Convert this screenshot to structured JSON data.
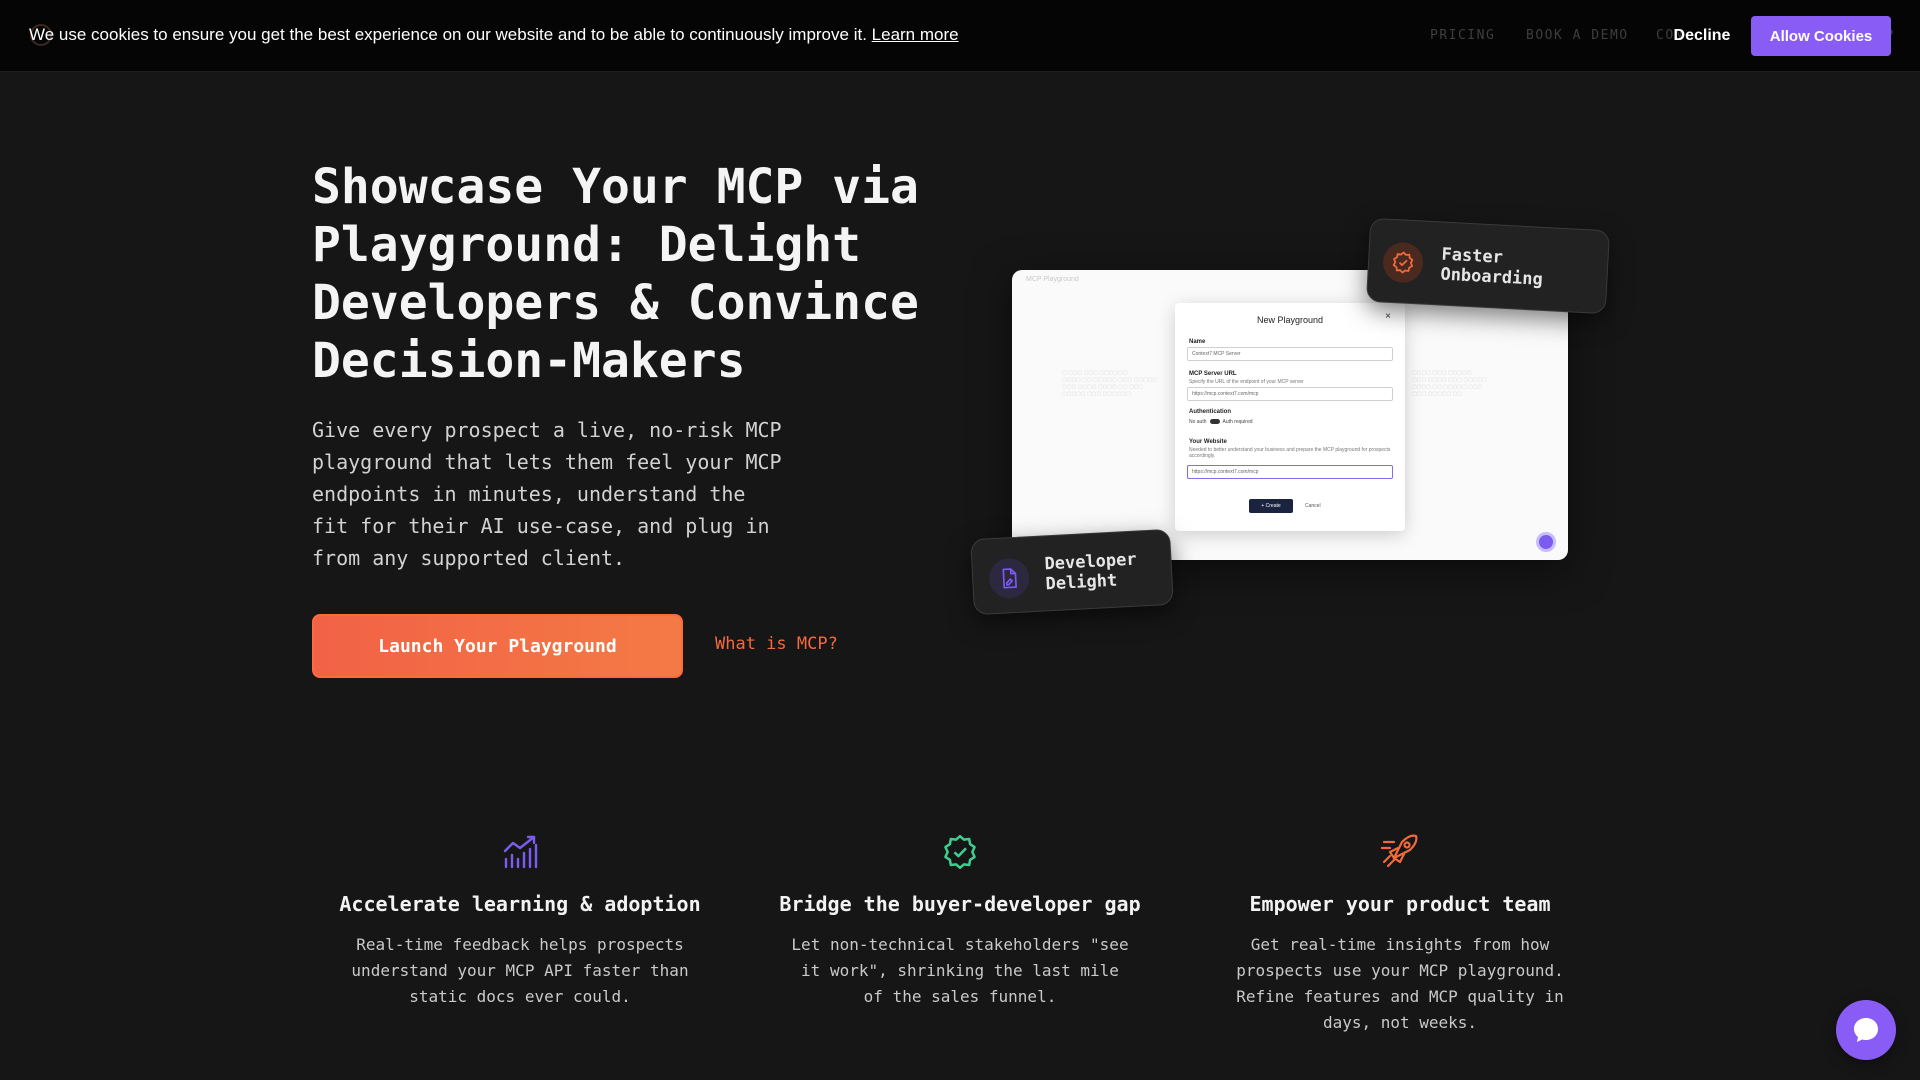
{
  "nav": {
    "items": [
      "PRICING",
      "BOOK A DEMO",
      "CON",
      "UP"
    ]
  },
  "cookie": {
    "message": "We use cookies to ensure you get the best experience on our website and to be able to continuously improve it.",
    "learn_more": "Learn more",
    "decline": "Decline",
    "allow": "Allow Cookies"
  },
  "hero": {
    "title": "Showcase Your MCP via Playground: Delight Developers & Convince Decision-Makers",
    "subtitle": "Give every prospect a live, no-risk MCP playground that lets them feel your MCP endpoints in minutes, understand the fit for their AI use-case, and plug in from any supported client.",
    "cta_primary": "Launch Your Playground",
    "cta_secondary": "What is MCP?"
  },
  "illustration": {
    "window_title": "MCP Playground",
    "dialog": {
      "title": "New Playground",
      "close": "×",
      "name_label": "Name",
      "name_value": "Context7 MCP Server",
      "url_label": "MCP Server URL",
      "url_help": "Specify the URL of the endpoint of your MCP server",
      "url_value": "https://mcp.context7.com/mcp",
      "auth_label": "Authentication",
      "auth_off": "No auth",
      "auth_on": "Auth required",
      "website_label": "Your Website",
      "website_help": "Needed to better understand your business and prepare the MCP playground for prospects accordingly.",
      "website_value": "https://mcp.context7.com/mcp",
      "create": "+ Create",
      "cancel": "Cancel"
    },
    "badge_faster": "Faster Onboarding",
    "badge_dev": "Developer Delight"
  },
  "features": [
    {
      "icon": "chart-growth-icon",
      "title": "Accelerate learning & adoption",
      "desc": "Real-time feedback helps prospects understand your MCP API faster than static docs ever could.",
      "color": "#7b5cf0"
    },
    {
      "icon": "verified-badge-icon",
      "title": "Bridge the buyer-developer gap",
      "desc": "Let non-technical stakeholders \"see it work\", shrinking the last mile of the sales funnel.",
      "color": "#3ecf8e"
    },
    {
      "icon": "rocket-icon",
      "title": "Empower your product team",
      "desc": "Get real-time insights from how prospects use your MCP playground. Refine features and MCP quality in days, not weeks.",
      "color": "#f26a3c"
    }
  ],
  "colors": {
    "accent_purple": "#8a5cf6",
    "accent_orange": "#f26a3c",
    "background": "#161616"
  }
}
